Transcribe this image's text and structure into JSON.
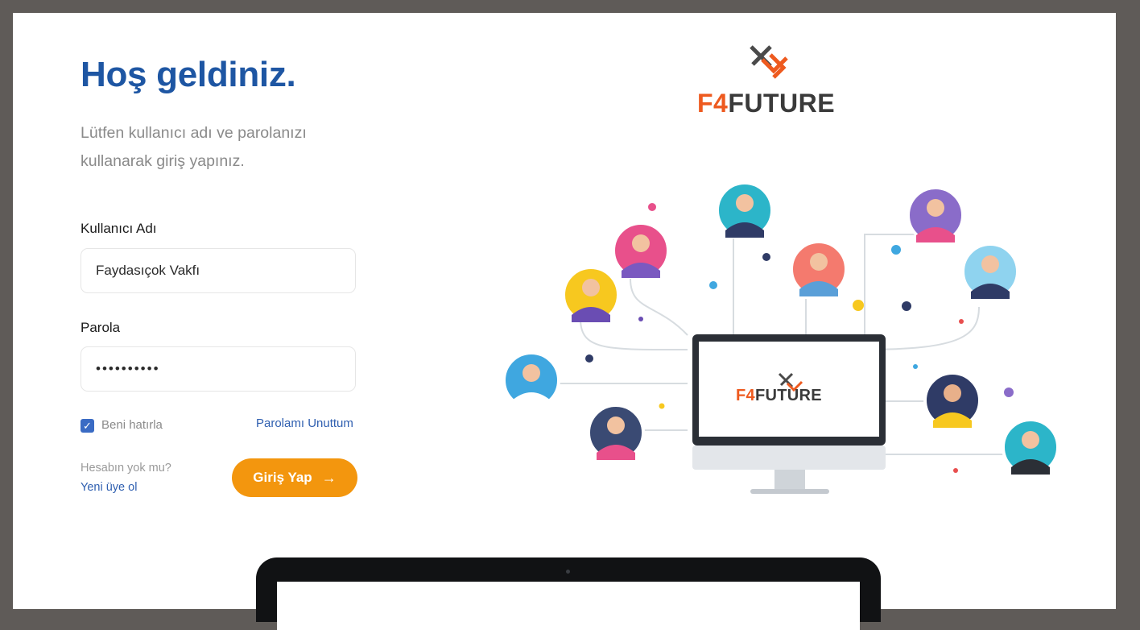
{
  "heading": "Hoş geldiniz.",
  "subtitle": "Lütfen kullanıcı adı ve parolanızı kullanarak giriş yapınız.",
  "form": {
    "username_label": "Kullanıcı Adı",
    "username_value": "Faydasıçok Vakfı",
    "password_label": "Parola",
    "password_value": "••••••••••",
    "remember_label": "Beni hatırla",
    "remember_checked": true,
    "forgot_link": "Parolamı Unuttum",
    "no_account_text": "Hesabın yok mu?",
    "signup_link": "Yeni üye ol",
    "login_button": "Giriş Yap",
    "login_arrow": "→"
  },
  "brand": {
    "logo_prefix": "F4",
    "logo_suffix": "FUTURE",
    "monitor_logo_prefix": "F4",
    "monitor_logo_suffix": "FUTURE"
  },
  "colors": {
    "heading": "#1e56a3",
    "link": "#2f5fb0",
    "button": "#f3960e",
    "brand_accent": "#ee5a1f",
    "frame": "#5f5b58"
  },
  "icons": {
    "checkbox": "check-icon",
    "button_arrow": "arrow-right-icon",
    "logo_mark": "f4-logo-mark-icon"
  }
}
